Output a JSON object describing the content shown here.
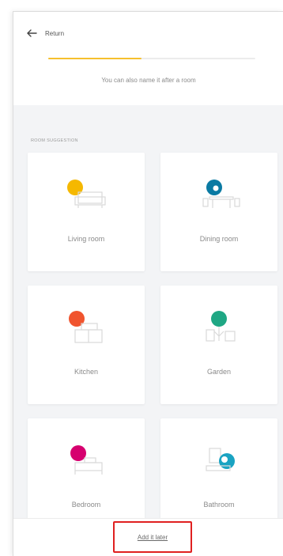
{
  "header": {
    "back_label": "Return",
    "progress": 0.45,
    "hint": "You can also name it after a room"
  },
  "section": {
    "label": "Room suggestion"
  },
  "rooms": [
    {
      "label": "Living room",
      "icon": "sofa-icon",
      "color": "#f5b800"
    },
    {
      "label": "Dining room",
      "icon": "dining-table-icon",
      "color": "#0a7aa3"
    },
    {
      "label": "Kitchen",
      "icon": "kitchen-icon",
      "color": "#f0542e"
    },
    {
      "label": "Garden",
      "icon": "garden-icon",
      "color": "#1fa784"
    },
    {
      "label": "Bedroom",
      "icon": "bed-icon",
      "color": "#d6006f"
    },
    {
      "label": "Bathroom",
      "icon": "bathtub-icon",
      "color": "#1aa3c2"
    }
  ],
  "footer": {
    "add_later_label": "Add it later"
  },
  "colors": {
    "accent": "#f6c02e",
    "highlight_border": "#e02020"
  }
}
